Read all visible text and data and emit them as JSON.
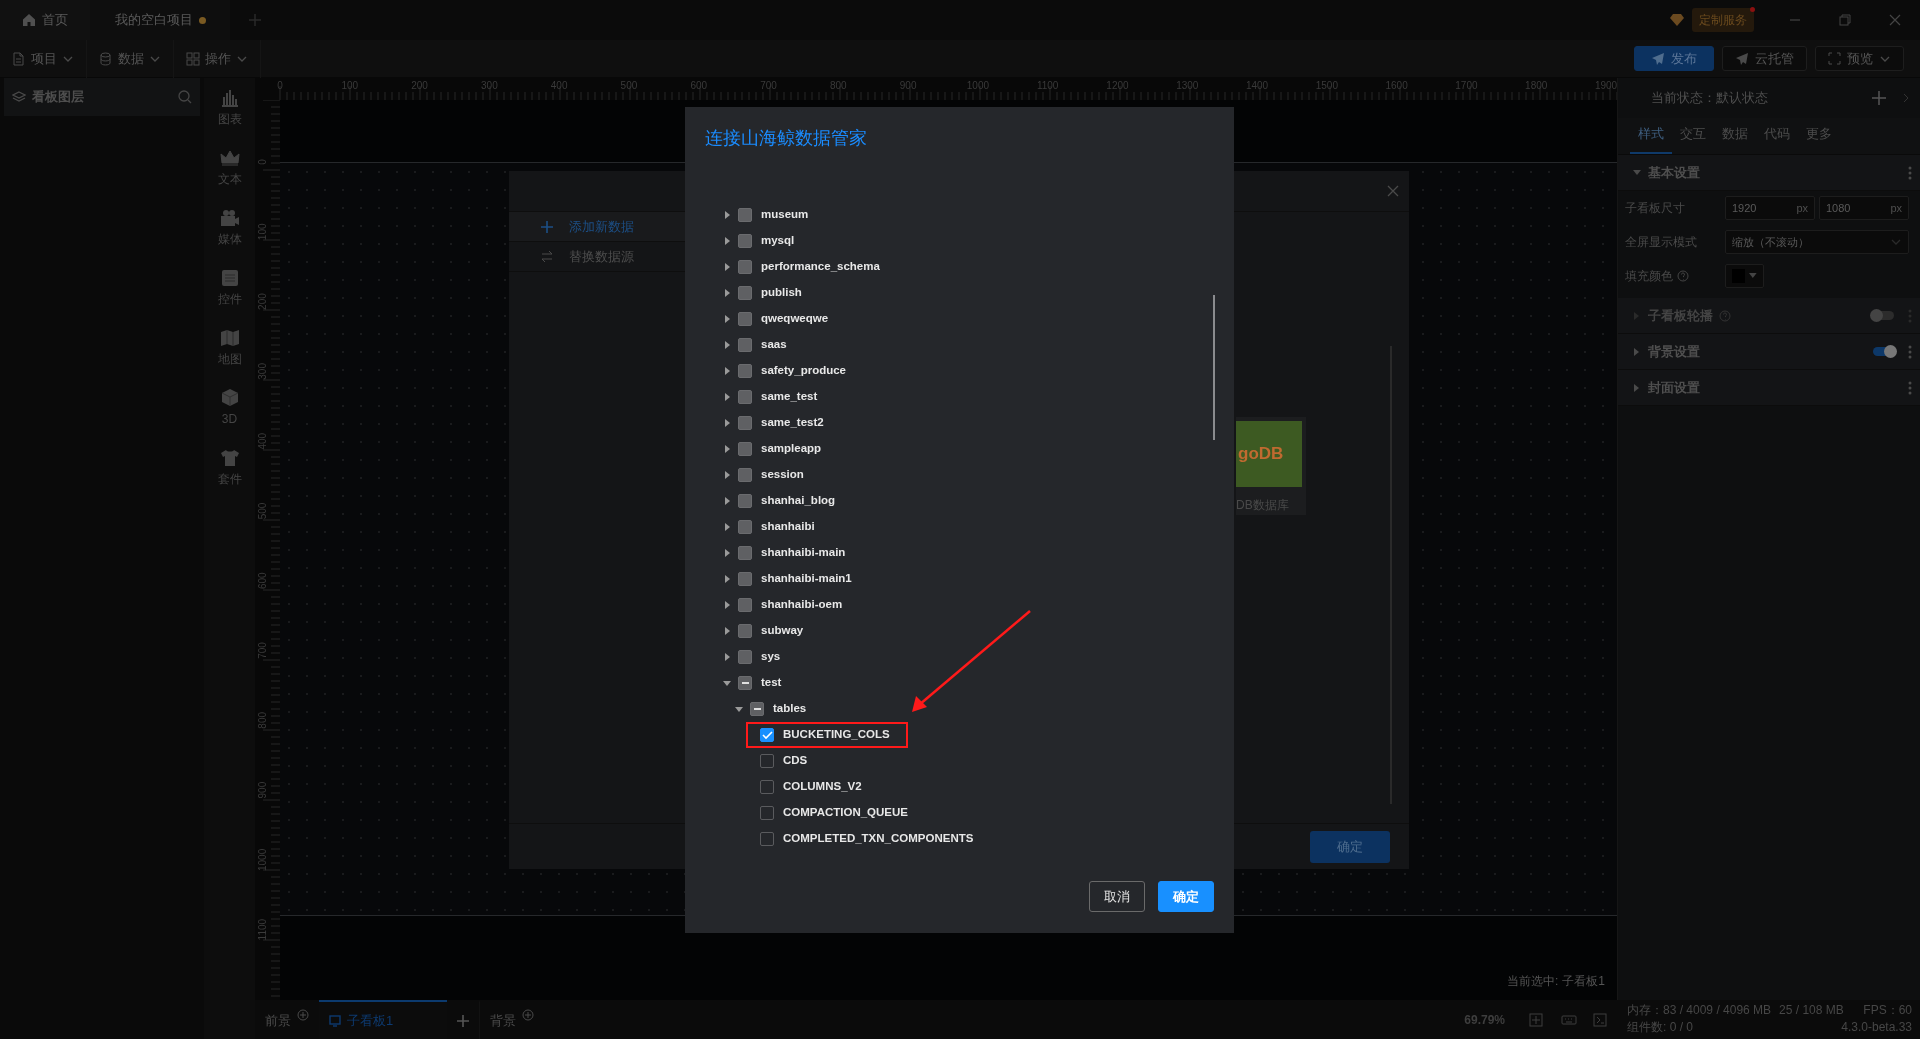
{
  "title_bar": {
    "tabs": [
      {
        "kind": "home",
        "label": "首页"
      },
      {
        "kind": "project",
        "label": "我的空白项目",
        "unsaved": true
      }
    ],
    "service_badge": "定制服务"
  },
  "toolbar": {
    "menus": [
      {
        "kind": "project",
        "label": "项目"
      },
      {
        "kind": "data",
        "label": "数据"
      },
      {
        "kind": "operation",
        "label": "操作"
      }
    ],
    "actions": [
      {
        "kind": "publish",
        "label": "发布"
      },
      {
        "kind": "cloud",
        "label": "云托管"
      },
      {
        "kind": "preview",
        "label": "预览"
      }
    ]
  },
  "layers_panel": {
    "title": "看板图层"
  },
  "component_bar": [
    {
      "kind": "chart",
      "label": "图表"
    },
    {
      "kind": "text",
      "label": "文本"
    },
    {
      "kind": "media",
      "label": "媒体"
    },
    {
      "kind": "control",
      "label": "控件"
    },
    {
      "kind": "map",
      "label": "地图"
    },
    {
      "kind": "model",
      "label": "3D"
    },
    {
      "kind": "kit",
      "label": "套件"
    }
  ],
  "ruler": {
    "horizontal": [
      "0",
      "100",
      "200",
      "300",
      "400",
      "500",
      "600",
      "700",
      "800",
      "900",
      "1000",
      "1100",
      "1200",
      "1300",
      "1400",
      "1500",
      "1600",
      "1700",
      "1800",
      "1900"
    ],
    "vertical": [
      "0",
      "100",
      "200",
      "300",
      "400",
      "500",
      "600",
      "700",
      "800",
      "900",
      "1000",
      "1100"
    ]
  },
  "canvas": {
    "selection_label": "当前选中:",
    "selection_value": "子看板1"
  },
  "properties_panel": {
    "state": "当前状态：默认状态",
    "tabs": [
      {
        "label": "样式",
        "selected": true
      },
      {
        "label": "交互",
        "selected": false
      },
      {
        "label": "数据",
        "selected": false
      },
      {
        "label": "代码",
        "selected": false
      },
      {
        "label": "更多",
        "selected": false
      }
    ],
    "sections": [
      {
        "title": "基本设置",
        "expanded": true,
        "rows": [
          {
            "kind": "size",
            "label": "子看板尺寸",
            "values": [
              {
                "value": "1920",
                "unit": "px"
              },
              {
                "value": "1080",
                "unit": "px"
              }
            ]
          },
          {
            "kind": "select",
            "label": "全屏显示模式",
            "value": "缩放（不滚动）"
          },
          {
            "kind": "color",
            "label": "填充颜色",
            "help": true
          }
        ]
      },
      {
        "title": "子看板轮播",
        "expanded": false,
        "help": true,
        "disabled": true,
        "toggle_on": false
      },
      {
        "title": "背景设置",
        "expanded": false,
        "disabled": false,
        "toggle_on": true
      },
      {
        "title": "封面设置",
        "expanded": false
      }
    ]
  },
  "bottom_bar": {
    "tabs": [
      {
        "kind": "layer",
        "label": "前景",
        "selected": false
      },
      {
        "kind": "board",
        "label": "子看板1",
        "selected": true
      },
      {
        "kind": "add"
      },
      {
        "kind": "layer",
        "label": "背景",
        "selected": false
      }
    ],
    "zoom": "69.79%",
    "memory": "内存：83 / 4009 / 4096 MB",
    "gpu_memory": "25 / 108 MB",
    "fps": "FPS：60",
    "components": "组件数: 0 / 0",
    "version": "4.3.0-beta.33"
  },
  "data_dialog": {
    "menu": [
      {
        "kind": "add",
        "label": "添加新数据",
        "selected": true
      },
      {
        "kind": "replace",
        "label": "替换数据源",
        "selected": false
      }
    ],
    "source_card": {
      "logo_text": "goDB",
      "label": "DB数据库"
    },
    "confirm": "确定"
  },
  "connect_dialog": {
    "title": "连接山海鲸数据管家",
    "tree": [
      {
        "label": "museum",
        "expanded": false,
        "checked": false,
        "indeterminate": false
      },
      {
        "label": "mysql",
        "expanded": false,
        "checked": false,
        "indeterminate": false
      },
      {
        "label": "performance_schema",
        "expanded": false,
        "checked": false,
        "indeterminate": false
      },
      {
        "label": "publish",
        "expanded": false,
        "checked": false,
        "indeterminate": false
      },
      {
        "label": "qweqweqwe",
        "expanded": false,
        "checked": false,
        "indeterminate": false
      },
      {
        "label": "saas",
        "expanded": false,
        "checked": false,
        "indeterminate": false
      },
      {
        "label": "safety_produce",
        "expanded": false,
        "checked": false,
        "indeterminate": false
      },
      {
        "label": "same_test",
        "expanded": false,
        "checked": false,
        "indeterminate": false
      },
      {
        "label": "same_test2",
        "expanded": false,
        "checked": false,
        "indeterminate": false
      },
      {
        "label": "sampleapp",
        "expanded": false,
        "checked": false,
        "indeterminate": false
      },
      {
        "label": "session",
        "expanded": false,
        "checked": false,
        "indeterminate": false
      },
      {
        "label": "shanhai_blog",
        "expanded": false,
        "checked": false,
        "indeterminate": false
      },
      {
        "label": "shanhaibi",
        "expanded": false,
        "checked": false,
        "indeterminate": false
      },
      {
        "label": "shanhaibi-main",
        "expanded": false,
        "checked": false,
        "indeterminate": false
      },
      {
        "label": "shanhaibi-main1",
        "expanded": false,
        "checked": false,
        "indeterminate": false
      },
      {
        "label": "shanhaibi-oem",
        "expanded": false,
        "checked": false,
        "indeterminate": false
      },
      {
        "label": "subway",
        "expanded": false,
        "checked": false,
        "indeterminate": false
      },
      {
        "label": "sys",
        "expanded": false,
        "checked": false,
        "indeterminate": false
      },
      {
        "label": "test",
        "expanded": true,
        "checked": false,
        "indeterminate": true,
        "children": [
          {
            "label": "tables",
            "expanded": true,
            "checked": false,
            "indeterminate": true,
            "children": [
              {
                "label": "BUCKETING_COLS",
                "checked": true,
                "highlighted": true
              },
              {
                "label": "CDS",
                "checked": false,
                "highlighted": false
              },
              {
                "label": "COLUMNS_V2",
                "checked": false,
                "highlighted": false
              },
              {
                "label": "COMPACTION_QUEUE",
                "checked": false,
                "highlighted": false
              },
              {
                "label": "COMPLETED_TXN_COMPONENTS",
                "checked": false,
                "highlighted": false
              }
            ]
          }
        ]
      }
    ],
    "buttons": [
      {
        "kind": "secondary",
        "label": "取消"
      },
      {
        "kind": "primary",
        "label": "确定"
      }
    ]
  }
}
